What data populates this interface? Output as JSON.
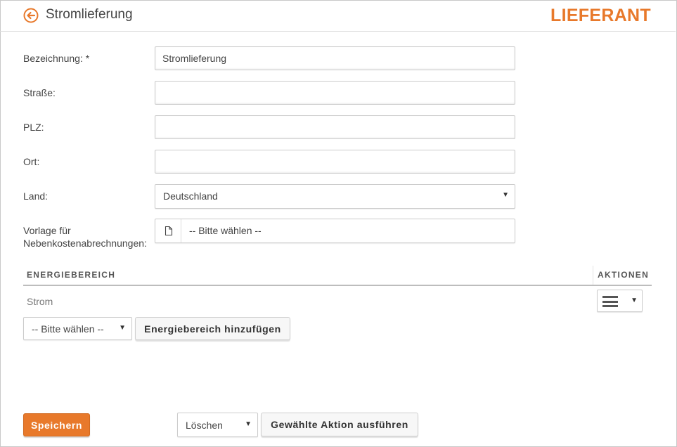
{
  "header": {
    "title": "Stromlieferung",
    "section": "LIEFERANT"
  },
  "form": {
    "bezeichnung": {
      "label": "Bezeichnung: *",
      "value": "Stromlieferung"
    },
    "strasse": {
      "label": "Straße:",
      "value": ""
    },
    "plz": {
      "label": "PLZ:",
      "value": ""
    },
    "ort": {
      "label": "Ort:",
      "value": ""
    },
    "land": {
      "label": "Land:",
      "value": "Deutschland"
    },
    "vorlage": {
      "label_line1": "Vorlage für",
      "label_line2": "Nebenkostenabrechnungen:",
      "value": "-- Bitte wählen --"
    }
  },
  "table": {
    "col_energiebereich": "ENERGIEBEREICH",
    "col_aktionen": "AKTIONEN",
    "rows": [
      {
        "name": "Strom"
      }
    ]
  },
  "add_energiebereich": {
    "select_value": "-- Bitte wählen --",
    "button_label": "Energiebereich hinzufügen"
  },
  "footer": {
    "save_label": "Speichern",
    "action_select_value": "Löschen",
    "execute_label": "Gewählte Aktion ausführen"
  },
  "colors": {
    "accent": "#e8792b",
    "text": "#444444"
  }
}
